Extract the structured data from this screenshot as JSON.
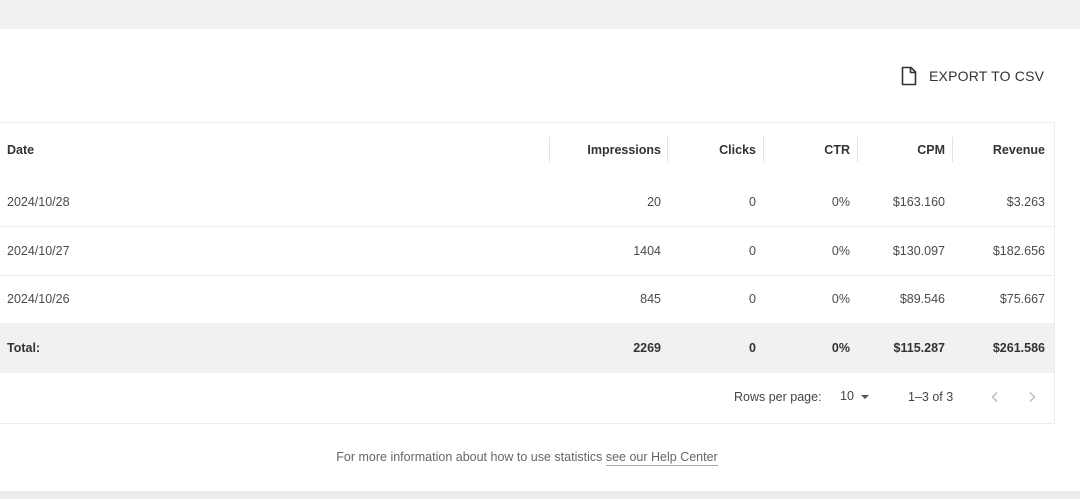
{
  "toolbar": {
    "export_label": "EXPORT TO CSV",
    "export_icon": "file-icon"
  },
  "table": {
    "columns": [
      "Date",
      "Impressions",
      "Clicks",
      "CTR",
      "CPM",
      "Revenue"
    ],
    "rows": [
      [
        "2024/10/28",
        "20",
        "0",
        "0%",
        "$163.160",
        "$3.263"
      ],
      [
        "2024/10/27",
        "1404",
        "0",
        "0%",
        "$130.097",
        "$182.656"
      ],
      [
        "2024/10/26",
        "845",
        "0",
        "0%",
        "$89.546",
        "$75.667"
      ]
    ],
    "total": [
      "Total:",
      "2269",
      "0",
      "0%",
      "$115.287",
      "$261.586"
    ]
  },
  "pagination": {
    "rows_per_page_label": "Rows per page:",
    "rows_per_page_value": "10",
    "range": "1–3 of 3",
    "prev_icon": "chevron-left-icon",
    "next_icon": "chevron-right-icon"
  },
  "help": {
    "text": "For more information about how to use statistics",
    "link_text": "see our Help Center"
  }
}
